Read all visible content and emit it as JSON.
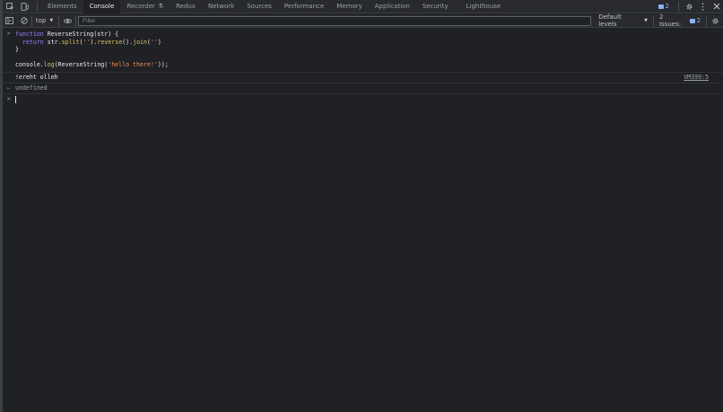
{
  "tabbar": {
    "tabs": [
      {
        "label": "Elements"
      },
      {
        "label": "Console"
      },
      {
        "label": "Recorder"
      },
      {
        "label": "Redux"
      },
      {
        "label": "Network"
      },
      {
        "label": "Sources"
      },
      {
        "label": "Performance"
      },
      {
        "label": "Memory"
      },
      {
        "label": "Application"
      },
      {
        "label": "Security"
      },
      {
        "label": "Lighthouse"
      }
    ],
    "active_tab": "Console",
    "messages_count": "2"
  },
  "toolbar": {
    "context": "top",
    "filter_placeholder": "Filter",
    "levels_label": "Default levels",
    "issues_label": "2 Issues:",
    "issues_count": "2"
  },
  "console": {
    "code": {
      "l1": {
        "a": "function",
        "b": " ReverseString(str) {"
      },
      "l2": {
        "a": "  return",
        "b": " str.",
        "c": "split",
        "d": "(",
        "e": "''",
        "f": ").",
        "g": "reverse",
        "h": "().",
        "i": "join",
        "j": "(",
        "k": "''",
        "l": ")"
      },
      "l3": "}",
      "l5": {
        "a": "console.",
        "b": "log",
        "c": "(ReverseString(",
        "d": "'hello there!'",
        "e": "));"
      }
    },
    "output": "!ereht olleh",
    "source": "VM399:5",
    "result": "undefined"
  },
  "colors": {
    "background": "#202124",
    "keyword": "#9980ff",
    "string": "#f28b54",
    "method": "#d7c263",
    "link": "#8ab4f8"
  }
}
